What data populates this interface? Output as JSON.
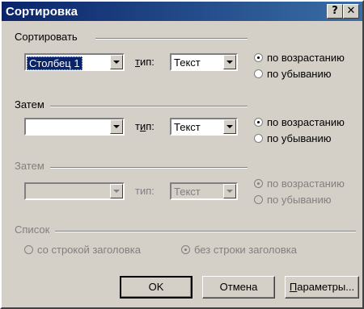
{
  "window": {
    "title": "Сортировка",
    "help_button": "?",
    "close_button": "✕"
  },
  "sort_by": {
    "group_label": "Сортировать",
    "column_value": "Столбец 1",
    "type_label": "тип:",
    "type_value": "Текст",
    "ascending_label": "по возрастанию",
    "descending_label": "по убыванию",
    "selected": "ascending"
  },
  "then_by_1": {
    "group_label": "Затем",
    "column_value": "",
    "type_label": "тип:",
    "type_value": "Текст",
    "ascending_label": "по возрастанию",
    "descending_label": "по убыванию",
    "selected": "ascending"
  },
  "then_by_2": {
    "group_label": "Затем",
    "column_value": "",
    "type_label": "тип:",
    "type_value": "Текст",
    "ascending_label": "по возрастанию",
    "descending_label": "по убыванию",
    "selected": "ascending",
    "disabled": true
  },
  "list": {
    "group_label": "Список",
    "with_header_label": "со строкой заголовка",
    "without_header_label": "без строки заголовка",
    "selected": "without_header",
    "disabled": true
  },
  "buttons": {
    "ok": "OK",
    "cancel": "Отмена",
    "options": "Параметры..."
  },
  "colors": {
    "face": "#d4d0c8",
    "titlebar": "#0a246a",
    "disabled_text": "#808080"
  }
}
